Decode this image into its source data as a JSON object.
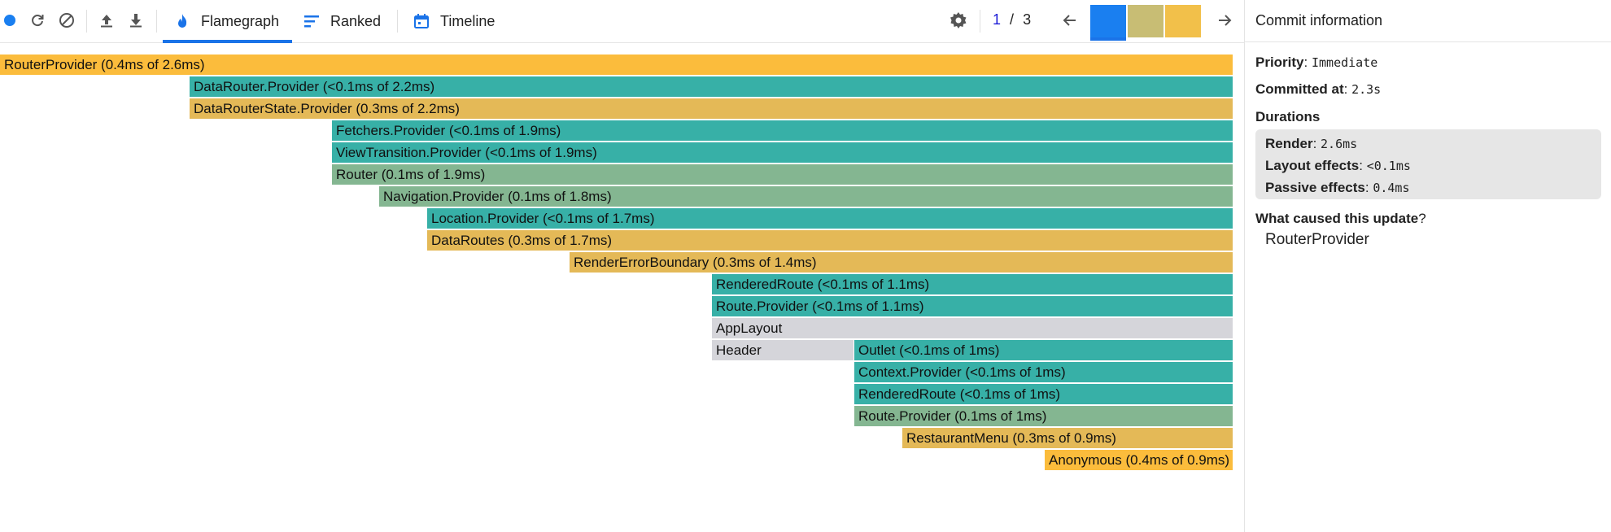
{
  "toolbar": {
    "tabs": [
      {
        "label": "Flamegraph",
        "icon": "flame-icon",
        "active": true
      },
      {
        "label": "Ranked",
        "icon": "ranked-icon",
        "active": false
      },
      {
        "label": "Timeline",
        "icon": "calendar-icon",
        "active": false
      }
    ],
    "commit_index": "1",
    "commit_separator": "/",
    "commit_total": "3",
    "commit_bars": [
      {
        "level": 1.0,
        "color": "#1a7ff0",
        "selected": true
      },
      {
        "level": 1.0,
        "color": "#c8bd74",
        "selected": false
      },
      {
        "level": 1.0,
        "color": "#f2c04a",
        "selected": false
      }
    ],
    "accent_color": "#1a73e8",
    "record_color": "#1a7ff0"
  },
  "flamegraph": {
    "frames": [
      {
        "label": "RouterProvider (0.4ms of 2.6ms)",
        "color": "#fbbc3c"
      },
      {
        "label": "DataRouter.Provider (<0.1ms of 2.2ms)",
        "color": "#37b0a7"
      },
      {
        "label": "DataRouterState.Provider (0.3ms of 2.2ms)",
        "color": "#e4b957"
      },
      {
        "label": "Fetchers.Provider (<0.1ms of 1.9ms)",
        "color": "#37b0a7"
      },
      {
        "label": "ViewTransition.Provider (<0.1ms of 1.9ms)",
        "color": "#37b0a7"
      },
      {
        "label": "Router (0.1ms of 1.9ms)",
        "color": "#84b691"
      },
      {
        "label": "Navigation.Provider (0.1ms of 1.8ms)",
        "color": "#84b691"
      },
      {
        "label": "Location.Provider (<0.1ms of 1.7ms)",
        "color": "#37b0a7"
      },
      {
        "label": "DataRoutes (0.3ms of 1.7ms)",
        "color": "#e4b957"
      },
      {
        "label": "RenderErrorBoundary (0.3ms of 1.4ms)",
        "color": "#e4b957"
      },
      {
        "label": "RenderedRoute (<0.1ms of 1.1ms)",
        "color": "#37b0a7"
      },
      {
        "label": "Route.Provider (<0.1ms of 1.1ms)",
        "color": "#37b0a7"
      },
      {
        "label": "AppLayout",
        "color": "#d5d5da"
      },
      {
        "label": "Header",
        "color": "#d5d5da"
      },
      {
        "label": "Outlet (<0.1ms of 1ms)",
        "color": "#37b0a7"
      },
      {
        "label": "Context.Provider (<0.1ms of 1ms)",
        "color": "#37b0a7"
      },
      {
        "label": "RenderedRoute (<0.1ms of 1ms)",
        "color": "#37b0a7"
      },
      {
        "label": "Route.Provider (0.1ms of 1ms)",
        "color": "#84b691"
      },
      {
        "label": "RestaurantMenu (0.3ms of 0.9ms)",
        "color": "#e4b957"
      },
      {
        "label": "Anonymous (0.4ms of 0.9ms)",
        "color": "#fbbc3c"
      }
    ]
  },
  "commit_info": {
    "title": "Commit information",
    "priority_label": "Priority",
    "priority_value": "Immediate",
    "committed_label": "Committed at",
    "committed_value": "2.3s",
    "durations_label": "Durations",
    "render_label": "Render",
    "render_value": "2.6ms",
    "layout_label": "Layout effects",
    "layout_value": "<0.1ms",
    "passive_label": "Passive effects",
    "passive_value": "0.4ms",
    "cause_label": "What caused this update",
    "cause_item": "RouterProvider"
  }
}
